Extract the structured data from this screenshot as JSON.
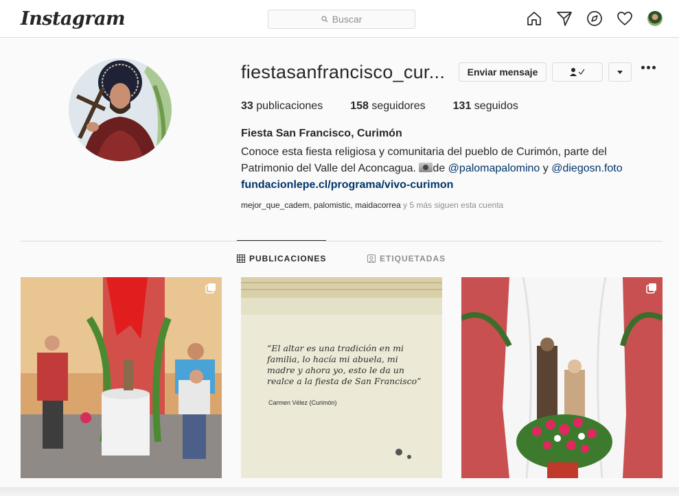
{
  "header": {
    "logo": "Instagram",
    "search_placeholder": "Buscar",
    "icons": [
      "home-icon",
      "direct-icon",
      "explore-icon",
      "activity-heart-icon",
      "profile-avatar"
    ]
  },
  "profile": {
    "username": "fiestasanfrancisco_cur...",
    "buttons": {
      "message": "Enviar mensaje",
      "following_icon": "person-check-icon",
      "dropdown_icon": "caret-down-icon",
      "more_icon": "more-options-icon"
    },
    "stats": {
      "posts_count": "33",
      "posts_label": "publicaciones",
      "followers_count": "158",
      "followers_label": "seguidores",
      "following_count": "131",
      "following_label": "seguidos"
    },
    "full_name": "Fiesta San Francisco, Curimón",
    "bio_line1": "Conoce esta fiesta religiosa y comunitaria del pueblo de Curimón, parte del",
    "bio_line2_a": "Patrimonio del Valle del Aconcagua. ",
    "bio_line2_b": "de ",
    "mention1": "@palomapalomino",
    "bio_and": " y ",
    "mention2": "@diegosn.foto",
    "website": "fundacionlepe.cl/programa/vivo-curimon",
    "followed_by_names": "mejor_que_cadem, palomistic, maidacorrea",
    "followed_by_more": " y 5 más siguen esta cuenta"
  },
  "tabs": [
    {
      "label": "PUBLICACIONES",
      "icon": "grid-icon",
      "active": true
    },
    {
      "label": "ETIQUETADAS",
      "icon": "tagged-icon",
      "active": false
    }
  ],
  "posts": [
    {
      "kind": "photo",
      "multi": true
    },
    {
      "kind": "quote",
      "multi": false,
      "quote": "“El altar es una tradición en mi familia, lo hacía mi abuela, mi madre y ahora yo, esto le da un realce a la fiesta de San Francisco”",
      "credit": "Carmen Vélez (Curimón)"
    },
    {
      "kind": "photo",
      "multi": true
    }
  ]
}
